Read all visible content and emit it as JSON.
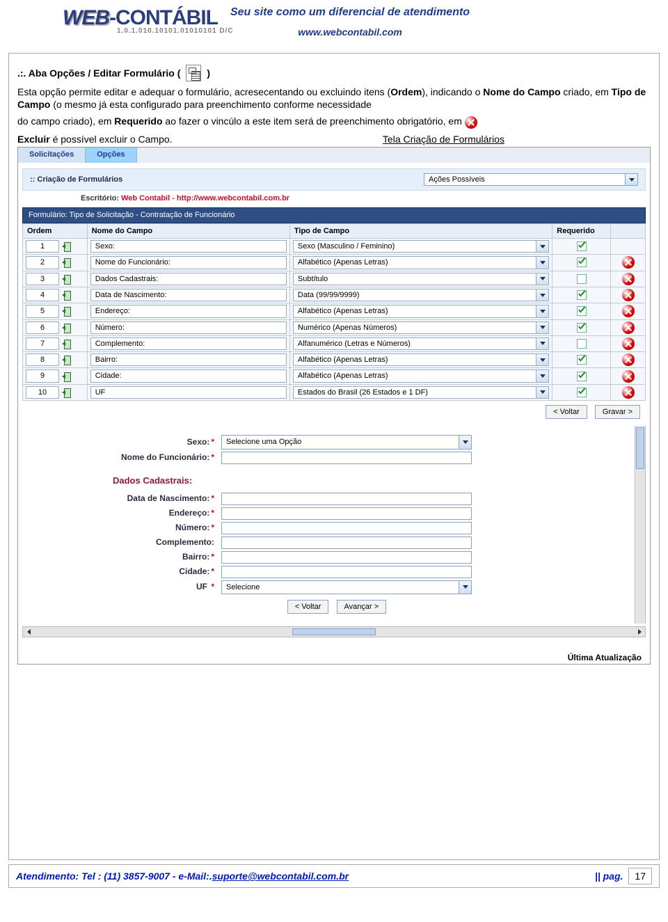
{
  "header": {
    "logo_web": "WEB",
    "logo_dash": "-",
    "logo_contabil": "CONTÁBIL",
    "logo_sub": "1.0.1.010.10101.01010101 D/C",
    "slogan": "Seu site como um diferencial de atendimento",
    "url": "www.webcontabil.com"
  },
  "text": {
    "section_prefix": ".:. Aba Opções / Editar Formulário (",
    "section_suffix": ")",
    "para1_a": "Esta opção permite editar e adequar o formulário, acresecentando ou excluindo itens (",
    "para1_bold1": "Ordem",
    "para1_b": "), indicando o ",
    "para1_bold2": "Nome do Campo",
    "para1_c": " criado, em ",
    "para1_bold3": "Tipo de Campo",
    "para1_d": " (o mesmo já esta configurado para preenchimento conforme necessidade",
    "para2_a": "do campo criado), em ",
    "para2_bold1": "Requerido",
    "para2_b": " ao fazer o vincúlo a este item será  de preenchimento obrigatório, em ",
    "para3_bold": "Excluir",
    "para3_a": " é possível excluir o Campo.",
    "caption": "Tela Criação de Formulários"
  },
  "tabs": {
    "solicitacoes": "Solicitações",
    "opcoes": "Opções"
  },
  "panel": {
    "title": ":: Criação de Formulários",
    "action_dd": "Ações Possíveis"
  },
  "office": {
    "label": "Escritório: ",
    "value": "Web Contabil - http://www.webcontabil.com.br"
  },
  "form_header": "Formulário: Tipo de Solicitação - Contratação de Funcionário",
  "columns": {
    "ordem": "Ordem",
    "nome": "Nome do Campo",
    "tipo": "Tipo de Campo",
    "req": "Requerido"
  },
  "rows": [
    {
      "ordem": "1",
      "nome": "Sexo:",
      "tipo": "Sexo (Masculino / Feminino)",
      "req": true,
      "del": false
    },
    {
      "ordem": "2",
      "nome": "Nome do Funcionário:",
      "tipo": "Alfabético (Apenas Letras)",
      "req": true,
      "del": true
    },
    {
      "ordem": "3",
      "nome": "Dados Cadastrais:",
      "tipo": "Subtítulo",
      "req": false,
      "del": true
    },
    {
      "ordem": "4",
      "nome": "Data de Nascimento:",
      "tipo": "Data (99/99/9999)",
      "req": true,
      "del": true
    },
    {
      "ordem": "5",
      "nome": "Endereço:",
      "tipo": "Alfabético (Apenas Letras)",
      "req": true,
      "del": true
    },
    {
      "ordem": "6",
      "nome": "Número:",
      "tipo": "Numérico (Apenas Números)",
      "req": true,
      "del": true
    },
    {
      "ordem": "7",
      "nome": "Complemento:",
      "tipo": "Alfanumérico (Letras e Números)",
      "req": false,
      "del": true
    },
    {
      "ordem": "8",
      "nome": "Bairro:",
      "tipo": "Alfabético (Apenas Letras)",
      "req": true,
      "del": true
    },
    {
      "ordem": "9",
      "nome": "Cidade:",
      "tipo": "Alfabético (Apenas Letras)",
      "req": true,
      "del": true
    },
    {
      "ordem": "10",
      "nome": "UF",
      "tipo": "Estados do Brasil (26 Estados e 1 DF)",
      "req": true,
      "del": true
    }
  ],
  "grid_buttons": {
    "voltar": "< Voltar",
    "gravar": "Gravar >"
  },
  "preview": {
    "sexo_label": "Sexo:",
    "sexo_value": "Selecione uma Opção",
    "nome_label": "Nome do Funcionário:",
    "subtitulo": "Dados Cadastrais:",
    "data_label": "Data de Nascimento:",
    "endereco_label": "Endereço:",
    "numero_label": "Número:",
    "complemento_label": "Complemento:",
    "bairro_label": "Bairro:",
    "cidade_label": "Cidade:",
    "uf_label": "UF",
    "uf_value": "Selecione",
    "voltar": "< Voltar",
    "avancar": "Avançar >"
  },
  "last_update": "Última Atualização",
  "footer": {
    "prefix": "Atendimento:  Tel : (11) 3857-9007 - e-Mail:. ",
    "email": "suporte@webcontabil.com.br",
    "pag_label": "||  pag.",
    "pag_num": "17"
  }
}
